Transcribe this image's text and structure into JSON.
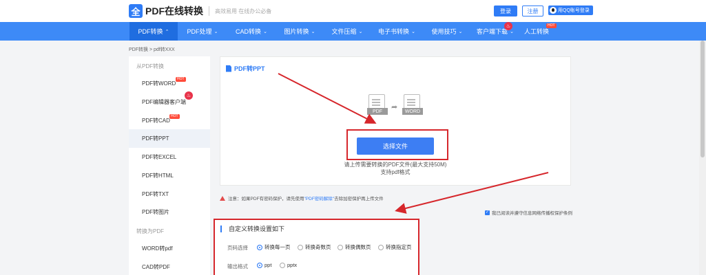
{
  "header": {
    "logo_glyph": "全",
    "logo_text": "PDF在线转换",
    "slogan": "高效易用 在线办公必备",
    "login": "登录",
    "register": "注册",
    "qq_login": "用QQ账号登录"
  },
  "nav": {
    "items": [
      {
        "label": "PDF转换",
        "chev": "⌃"
      },
      {
        "label": "PDF处理",
        "chev": "⌄"
      },
      {
        "label": "CAD转换",
        "chev": "⌄"
      },
      {
        "label": "图片转换",
        "chev": "⌄"
      },
      {
        "label": "文件压缩",
        "chev": "⌄"
      },
      {
        "label": "电子书转换",
        "chev": "⌄"
      },
      {
        "label": "使用技巧",
        "chev": "⌄"
      },
      {
        "label": "客户端下载",
        "chev": "⌄"
      },
      {
        "label": "人工转换",
        "chev": ""
      }
    ],
    "hot": "HOT"
  },
  "breadcrumb": "PDF转换 > pdf转XXX",
  "sidebar": {
    "section1": "从PDF转换",
    "items1": [
      "PDF转WORD",
      "PDF编辑器客户端",
      "PDF转CAD",
      "PDF转PPT",
      "PDF转EXCEL",
      "PDF转HTML",
      "PDF转TXT",
      "PDF转图片"
    ],
    "section2": "转换为PDF",
    "items2": [
      "WORD转pdf",
      "CAD转PDF"
    ],
    "hot": "HOT"
  },
  "upload": {
    "title": "PDF转PPT",
    "from_tag": "PDF",
    "to_tag": "WORD",
    "choose_button": "选择文件",
    "hint1": "请上传需要转换的PDF文件(最大支持50M)",
    "hint2": "支持pdf格式"
  },
  "notice": {
    "prefix": "注意：如果PDF有密码保护，请先使用",
    "link": "\"PDF密码解除\"",
    "suffix": "去除加密保护再上传文件"
  },
  "agree": "我已阅读并遵守信息网络传播权保护条例",
  "settings": {
    "title": "自定义转换设置如下",
    "page_label": "页码选择",
    "page_options": [
      "转换每一页",
      "转换奇数页",
      "转换偶数页",
      "转换指定页"
    ],
    "format_label": "输出格式",
    "format_options": [
      "ppt",
      "pptx"
    ]
  },
  "colors": {
    "accent": "#3d8af7",
    "highlight_box": "#d6262b",
    "hot_badge": "#ff4b3a"
  }
}
